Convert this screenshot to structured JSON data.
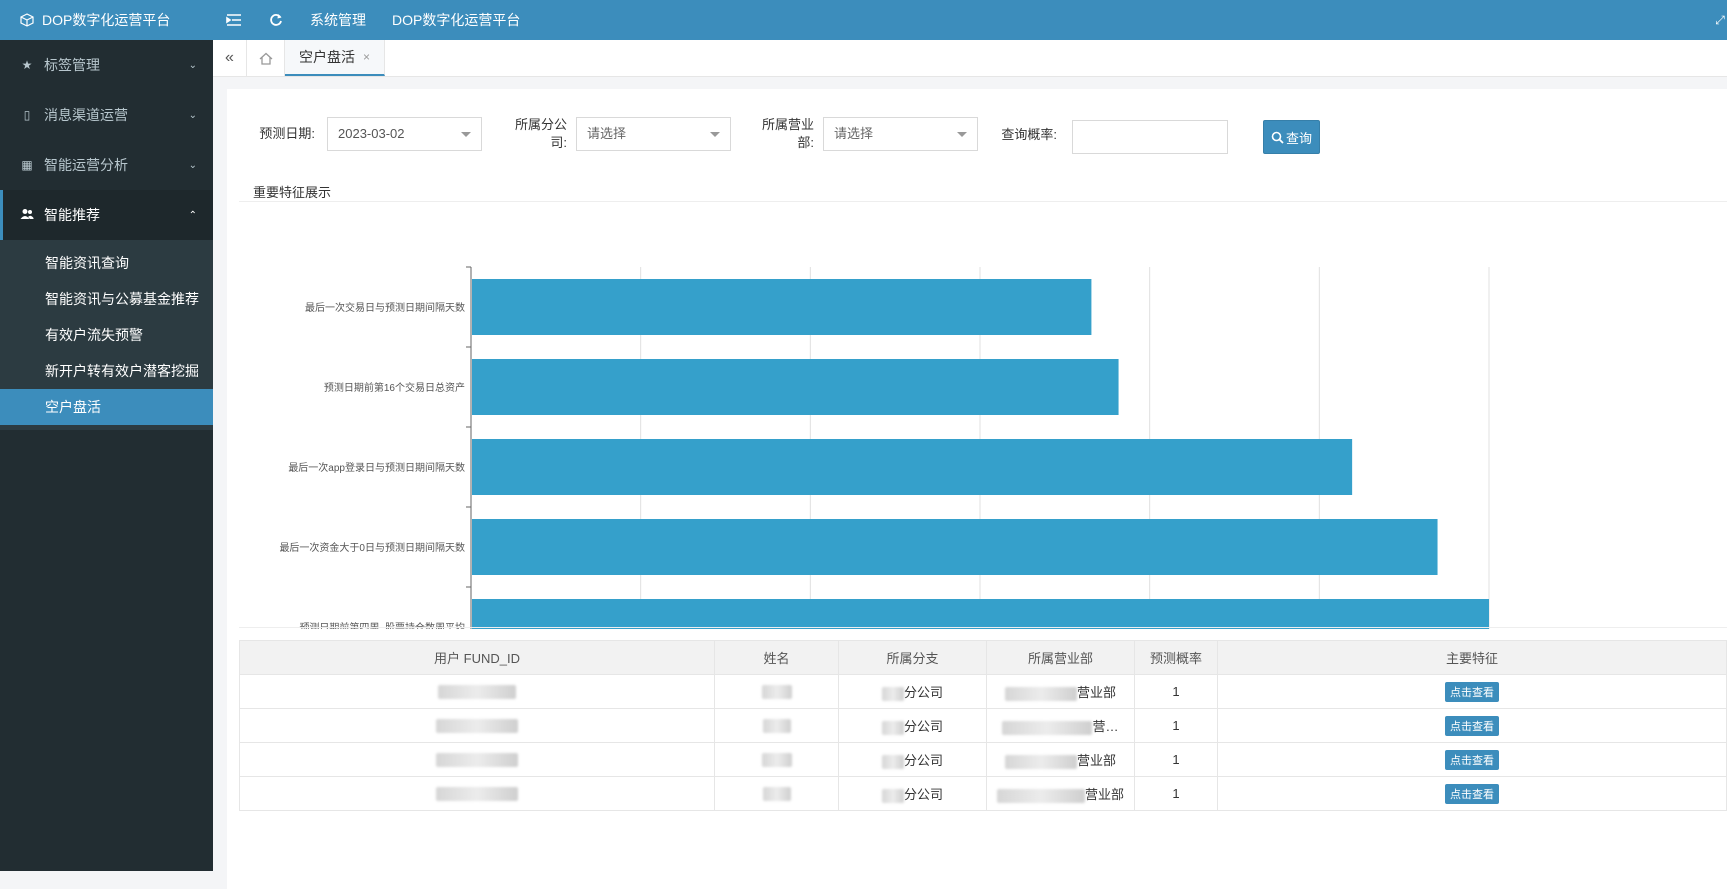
{
  "topbar": {
    "brand": "DOP数字化运营平台",
    "links": [
      "系统管理",
      "DOP数字化运营平台"
    ]
  },
  "sidebar": {
    "items": [
      {
        "label": "标签管理",
        "icon": "star-icon"
      },
      {
        "label": "消息渠道运营",
        "icon": "mobile-icon"
      },
      {
        "label": "智能运营分析",
        "icon": "grid-icon"
      },
      {
        "label": "智能推荐",
        "icon": "users-icon"
      }
    ],
    "subitems": [
      "智能资讯查询",
      "智能资讯与公募基金推荐",
      "有效户流失预警",
      "新开户转有效户潜客挖掘",
      "空户盘活"
    ]
  },
  "tabs": {
    "active": "空户盘活",
    "close": "×"
  },
  "filters": {
    "date_label": "预测日期:",
    "date_value": "2023-03-02",
    "company_label": "所属分公司:",
    "company_placeholder": "请选择",
    "dept_label": "所属营业部:",
    "dept_placeholder": "请选择",
    "prob_label": "查询概率:",
    "prob_value": "",
    "search_label": "查询"
  },
  "section": {
    "title": "重要特征展示"
  },
  "colors": {
    "accent": "#3c8dbc",
    "bar": "#35a0cb",
    "sidebar": "#222d32"
  },
  "chart_data": {
    "type": "bar",
    "orientation": "horizontal",
    "categories": [
      "最后一次交易日与预测日期间隔天数",
      "预测日期前第16个交易日总资产",
      "最后一次app登录日与预测日期间隔天数",
      "最后一次资金大于0日与预测日期间隔天数",
      "预测日期前第四周_股票持仓数周平均"
    ],
    "values": [
      0.1097,
      0.1145,
      0.1558,
      0.1709,
      0.18
    ],
    "xlim": [
      0,
      0.18
    ],
    "xticks": [
      "0",
      "0.03",
      "0.06",
      "0.09",
      "0.12",
      "0.15",
      "0.18"
    ],
    "grid": true
  },
  "table": {
    "headers": [
      "用户 FUND_ID",
      "姓名",
      "所属分支",
      "所属营业部",
      "预测概率",
      "主要特征"
    ],
    "rows": [
      {
        "branch_suffix": "分公司",
        "dept_suffix": "营业部",
        "prob": "1",
        "action": "点击查看"
      },
      {
        "branch_suffix": "分公司",
        "dept_suffix": "营…",
        "prob": "1",
        "action": "点击查看"
      },
      {
        "branch_suffix": "分公司",
        "dept_suffix": "营业部",
        "prob": "1",
        "action": "点击查看"
      },
      {
        "branch_suffix": "分公司",
        "dept_suffix": "营业部",
        "prob": "1",
        "action": "点击查看"
      }
    ]
  }
}
